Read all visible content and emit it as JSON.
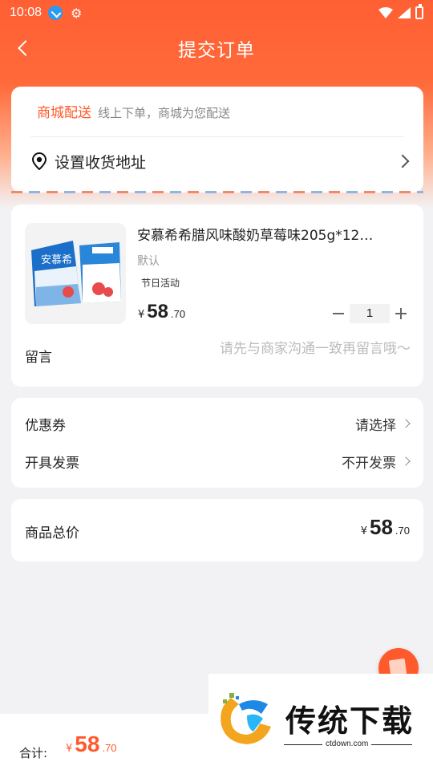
{
  "status_bar": {
    "time": "10:08"
  },
  "nav": {
    "title": "提交订单"
  },
  "delivery": {
    "mode": "商城配送",
    "description": "线上下单，商城为您配送",
    "address_prompt": "设置收货地址"
  },
  "product": {
    "title": "安慕希希腊风味酸奶草莓味205g*12…",
    "spec": "默认",
    "tag": "节日活动",
    "currency": "¥",
    "price_int": "58",
    "price_dec": ".70",
    "quantity": "1",
    "thumbnail_brand": "安慕希"
  },
  "message": {
    "label": "留言",
    "placeholder": "请先与商家沟通一致再留言哦～"
  },
  "options": {
    "coupon_label": "优惠券",
    "coupon_value": "请选择",
    "invoice_label": "开具发票",
    "invoice_value": "不开发票"
  },
  "total": {
    "label": "商品总价",
    "currency": "¥",
    "price_int": "58",
    "price_dec": ".70"
  },
  "bottom_bar": {
    "label": "合计:",
    "currency": "¥",
    "price_int": "58",
    "price_dec": ".70"
  },
  "watermark": {
    "text": "传统下载",
    "url": "ctdown.com"
  },
  "colors": {
    "accent": "#ff5a2c",
    "header": "#ff5f33"
  },
  "icons": [
    "back-icon",
    "download-icon",
    "gear-icon",
    "wifi-icon",
    "signal-icon",
    "battery-icon",
    "location-pin-icon",
    "chevron-right-icon",
    "minus-icon",
    "plus-icon"
  ]
}
